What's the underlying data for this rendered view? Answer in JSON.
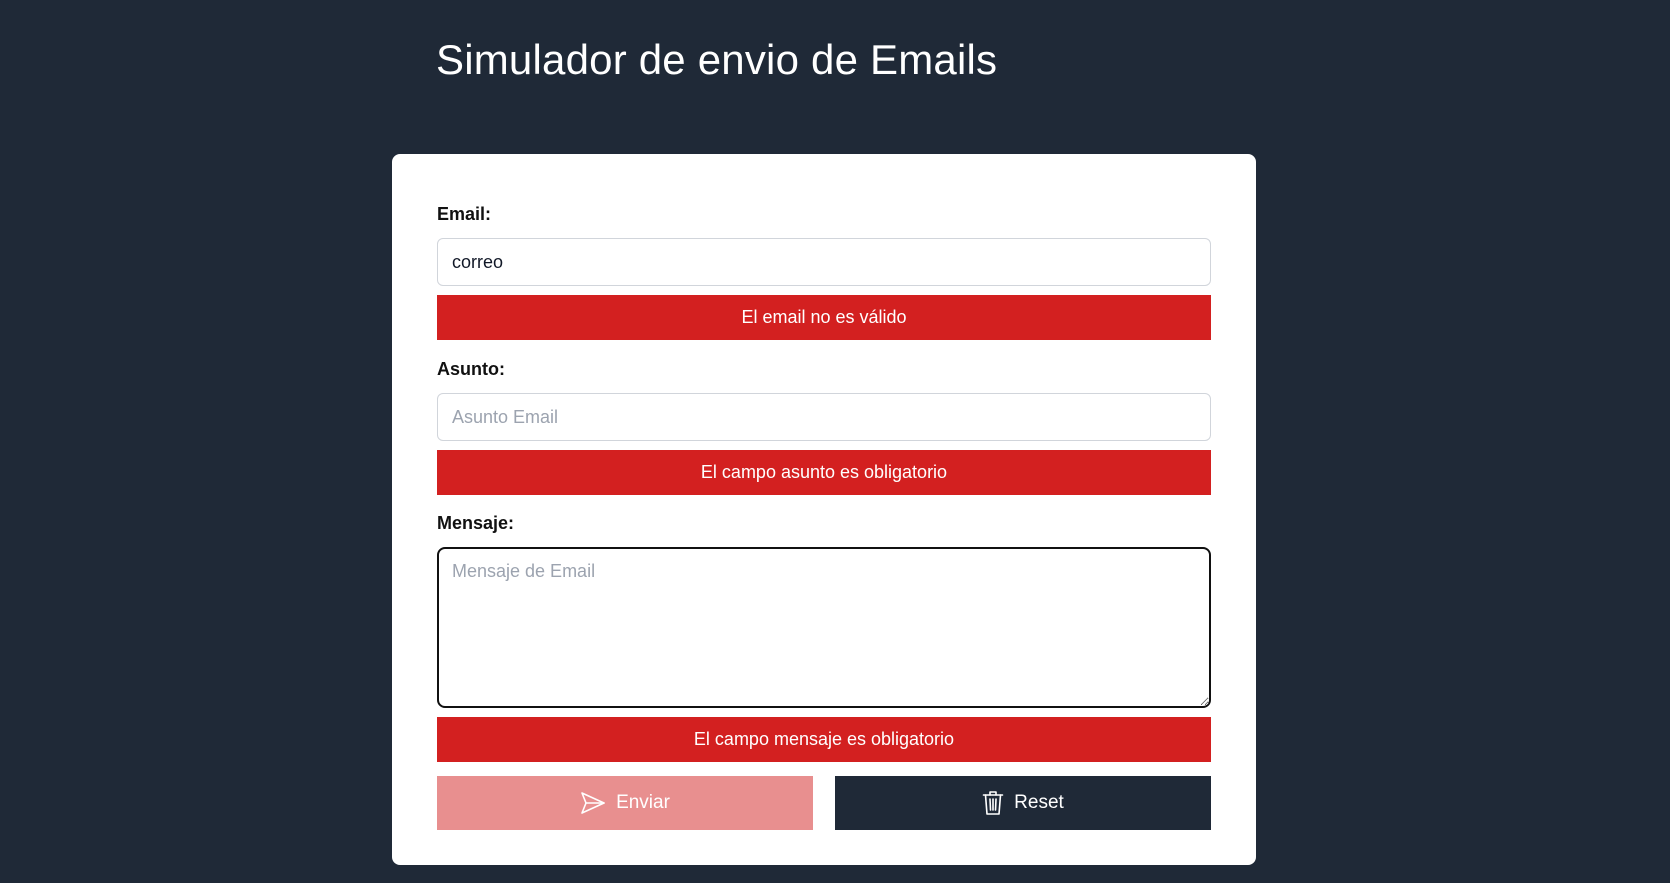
{
  "page": {
    "title": "Simulador de envio de Emails"
  },
  "form": {
    "email": {
      "label": "Email:",
      "value": "correo",
      "error": "El email no es válido"
    },
    "asunto": {
      "label": "Asunto:",
      "placeholder": "Asunto Email",
      "value": "",
      "error": "El campo asunto es obligatorio"
    },
    "mensaje": {
      "label": "Mensaje:",
      "placeholder": "Mensaje de Email",
      "value": "",
      "error": "El campo mensaje es obligatorio"
    },
    "buttons": {
      "send": {
        "label": "Enviar",
        "icon": "paper-plane-icon",
        "disabled": true
      },
      "reset": {
        "label": "Reset",
        "icon": "trash-icon"
      }
    }
  },
  "colors": {
    "background": "#1f2937",
    "card": "#ffffff",
    "error": "#d32020",
    "send_disabled": "#e88f8f",
    "reset": "#1f2937"
  }
}
